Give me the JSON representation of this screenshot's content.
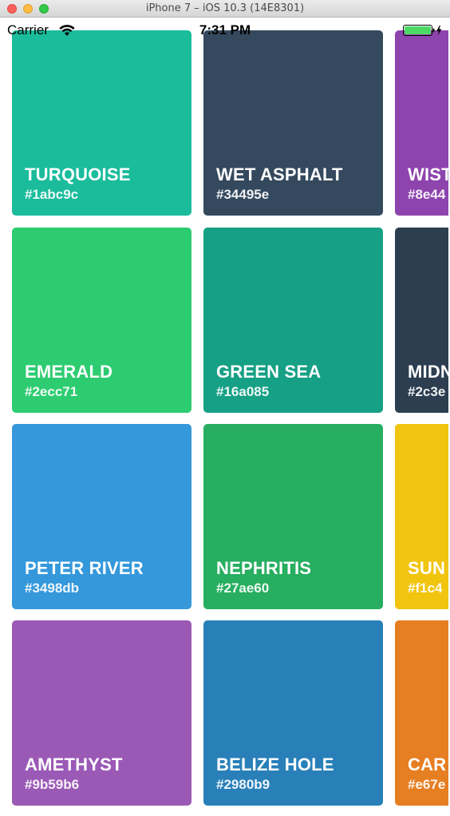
{
  "window": {
    "title": "iPhone 7 – iOS 10.3 (14E8301)"
  },
  "status_bar": {
    "carrier": "Carrier",
    "time": "7:31 PM"
  },
  "rows": [
    [
      {
        "name": "TURQUOISE",
        "hex": "#1abc9c",
        "color": "#1abc9c"
      },
      {
        "name": "WET ASPHALT",
        "hex": "#34495e",
        "color": "#34495e"
      },
      {
        "name": "WIST",
        "hex": "#8e44",
        "color": "#8e44ad"
      }
    ],
    [
      {
        "name": "EMERALD",
        "hex": "#2ecc71",
        "color": "#2ecc71"
      },
      {
        "name": "GREEN SEA",
        "hex": "#16a085",
        "color": "#16a085"
      },
      {
        "name": "MIDN",
        "hex": "#2c3e",
        "color": "#2c3e50"
      }
    ],
    [
      {
        "name": "PETER RIVER",
        "hex": "#3498db",
        "color": "#3498db"
      },
      {
        "name": "NEPHRITIS",
        "hex": "#27ae60",
        "color": "#27ae60"
      },
      {
        "name": "SUN",
        "hex": "#f1c4",
        "color": "#f1c40f"
      }
    ],
    [
      {
        "name": "AMETHYST",
        "hex": "#9b59b6",
        "color": "#9b59b6"
      },
      {
        "name": "BELIZE HOLE",
        "hex": "#2980b9",
        "color": "#2980b9"
      },
      {
        "name": "CAR",
        "hex": "#e67e",
        "color": "#e67e22"
      }
    ]
  ]
}
